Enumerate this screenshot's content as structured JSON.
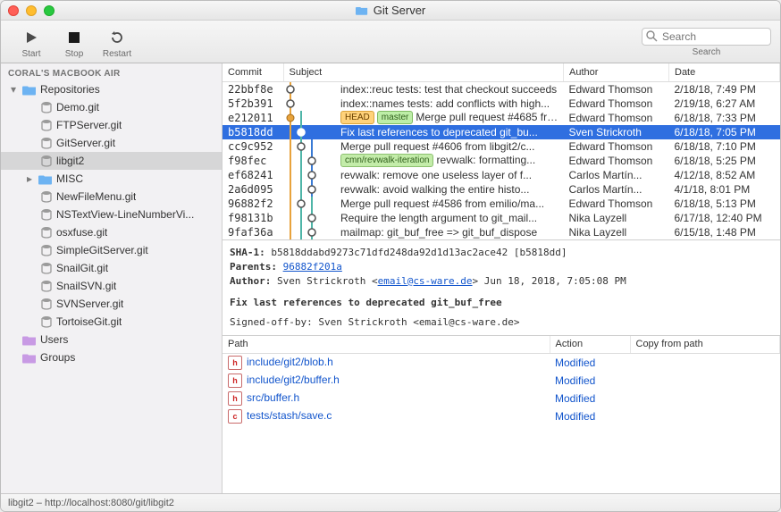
{
  "window": {
    "title": "Git Server"
  },
  "toolbar": {
    "start": "Start",
    "stop": "Stop",
    "restart": "Restart",
    "search_placeholder": "Search",
    "search_label": "Search"
  },
  "sidebar": {
    "header": "CORAL'S MACBOOK AIR",
    "repositories_label": "Repositories",
    "repo_items": [
      "Demo.git",
      "FTPServer.git",
      "GitServer.git",
      "libgit2",
      "MISC",
      "NewFileMenu.git",
      "NSTextView-LineNumberVi...",
      "osxfuse.git",
      "SimpleGitServer.git",
      "SnailGit.git",
      "SnailSVN.git",
      "SVNServer.git",
      "TortoiseGit.git"
    ],
    "users_label": "Users",
    "groups_label": "Groups"
  },
  "table": {
    "headers": {
      "commit": "Commit",
      "subject": "Subject",
      "author": "Author",
      "date": "Date"
    },
    "rows": [
      {
        "hash": "22bbf8e",
        "subject": "index::reuc tests: test that checkout succeeds",
        "author": "Edward Thomson",
        "date": "2/18/18, 7:49 PM"
      },
      {
        "hash": "5f2b391",
        "subject": "index::names tests: add conflicts with high...",
        "author": "Edward Thomson",
        "date": "2/19/18, 6:27 AM"
      },
      {
        "hash": "e212011",
        "tags": [
          "HEAD",
          "master"
        ],
        "subject": "Merge pull request #4685 fro...",
        "author": "Edward Thomson",
        "date": "6/18/18, 7:33 PM"
      },
      {
        "hash": "b5818dd",
        "subject": "Fix last references to deprecated git_bu...",
        "author": "Sven Strickroth",
        "date": "6/18/18, 7:05 PM",
        "selected": true
      },
      {
        "hash": "cc9c952",
        "subject": "Merge pull request #4606 from libgit2/c...",
        "author": "Edward Thomson",
        "date": "6/18/18, 7:10 PM"
      },
      {
        "hash": "f98fec",
        "tags_branch": "cmn/revwalk-iteration",
        "subject": "revwalk: formatting...",
        "author": "Edward Thomson",
        "date": "6/18/18, 5:25 PM"
      },
      {
        "hash": "ef68241",
        "subject": "revwalk: remove one useless layer of f...",
        "author": "Carlos Martín...",
        "date": "4/12/18, 8:52 AM"
      },
      {
        "hash": "2a6d095",
        "subject": "revwalk: avoid walking the entire histo...",
        "author": "Carlos Martín...",
        "date": "4/1/18, 8:01 PM"
      },
      {
        "hash": "96882f2",
        "subject": "Merge pull request #4586 from emilio/ma...",
        "author": "Edward Thomson",
        "date": "6/18/18, 5:13 PM"
      },
      {
        "hash": "f98131b",
        "subject": "Require the length argument to git_mail...",
        "author": "Nika Layzell",
        "date": "6/17/18, 12:40 PM"
      },
      {
        "hash": "9faf36a",
        "subject": "mailmap: git_buf_free => git_buf_dispose",
        "author": "Nika Layzell",
        "date": "6/15/18, 1:48 PM"
      }
    ]
  },
  "details": {
    "sha_label": "SHA-1:",
    "sha_value": "b5818ddabd9273c71dfd248da92d1d13ac2ace42 [b5818dd]",
    "parents_label": "Parents:",
    "parents_link": "96882f201a",
    "author_label": "Author:",
    "author_name": "Sven Strickroth <",
    "author_email": "email@cs-ware.de",
    "author_tail": "> Jun 18, 2018, 7:05:08 PM",
    "message_title": "Fix last references to deprecated git_buf_free",
    "signoff": "Signed-off-by: Sven Strickroth <email@cs-ware.de>"
  },
  "files": {
    "headers": {
      "path": "Path",
      "action": "Action",
      "copy": "Copy from path"
    },
    "rows": [
      {
        "icon": "h",
        "path": "include/git2/blob.h",
        "action": "Modified"
      },
      {
        "icon": "h",
        "path": "include/git2/buffer.h",
        "action": "Modified"
      },
      {
        "icon": "h",
        "path": "src/buffer.h",
        "action": "Modified"
      },
      {
        "icon": "c",
        "path": "tests/stash/save.c",
        "action": "Modified"
      }
    ]
  },
  "statusbar": "libgit2 – http://localhost:8080/git/libgit2"
}
